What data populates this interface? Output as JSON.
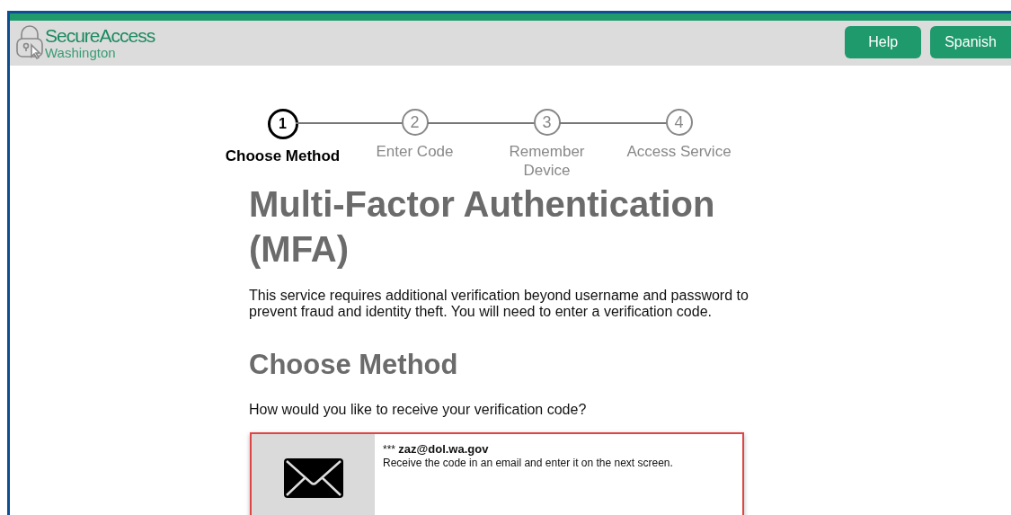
{
  "header": {
    "logo_title": "SecureAccess",
    "logo_subtitle": "Washington",
    "buttons": [
      "Help",
      "Spanish"
    ]
  },
  "steps": [
    {
      "number": "1",
      "label": "Choose Method",
      "selected": true
    },
    {
      "number": "2",
      "label": "Enter Code",
      "selected": false
    },
    {
      "number": "3",
      "label": "Remember Device",
      "selected": false
    },
    {
      "number": "4",
      "label": "Access Service",
      "selected": false
    }
  ],
  "title": "Multi-Factor Authentication (MFA)",
  "intro": "This service requires additional verification beyond username and password to prevent fraud and identity theft. You will need to enter a verification code.",
  "section_title": "Choose Method",
  "question": "How would you like to receive your verification code?",
  "methods": [
    {
      "kind": "email",
      "mask": "***",
      "address": "zaz@dol.wa.gov",
      "description": "Receive the code in an email and enter it on the next screen.",
      "selected": true
    }
  ]
}
